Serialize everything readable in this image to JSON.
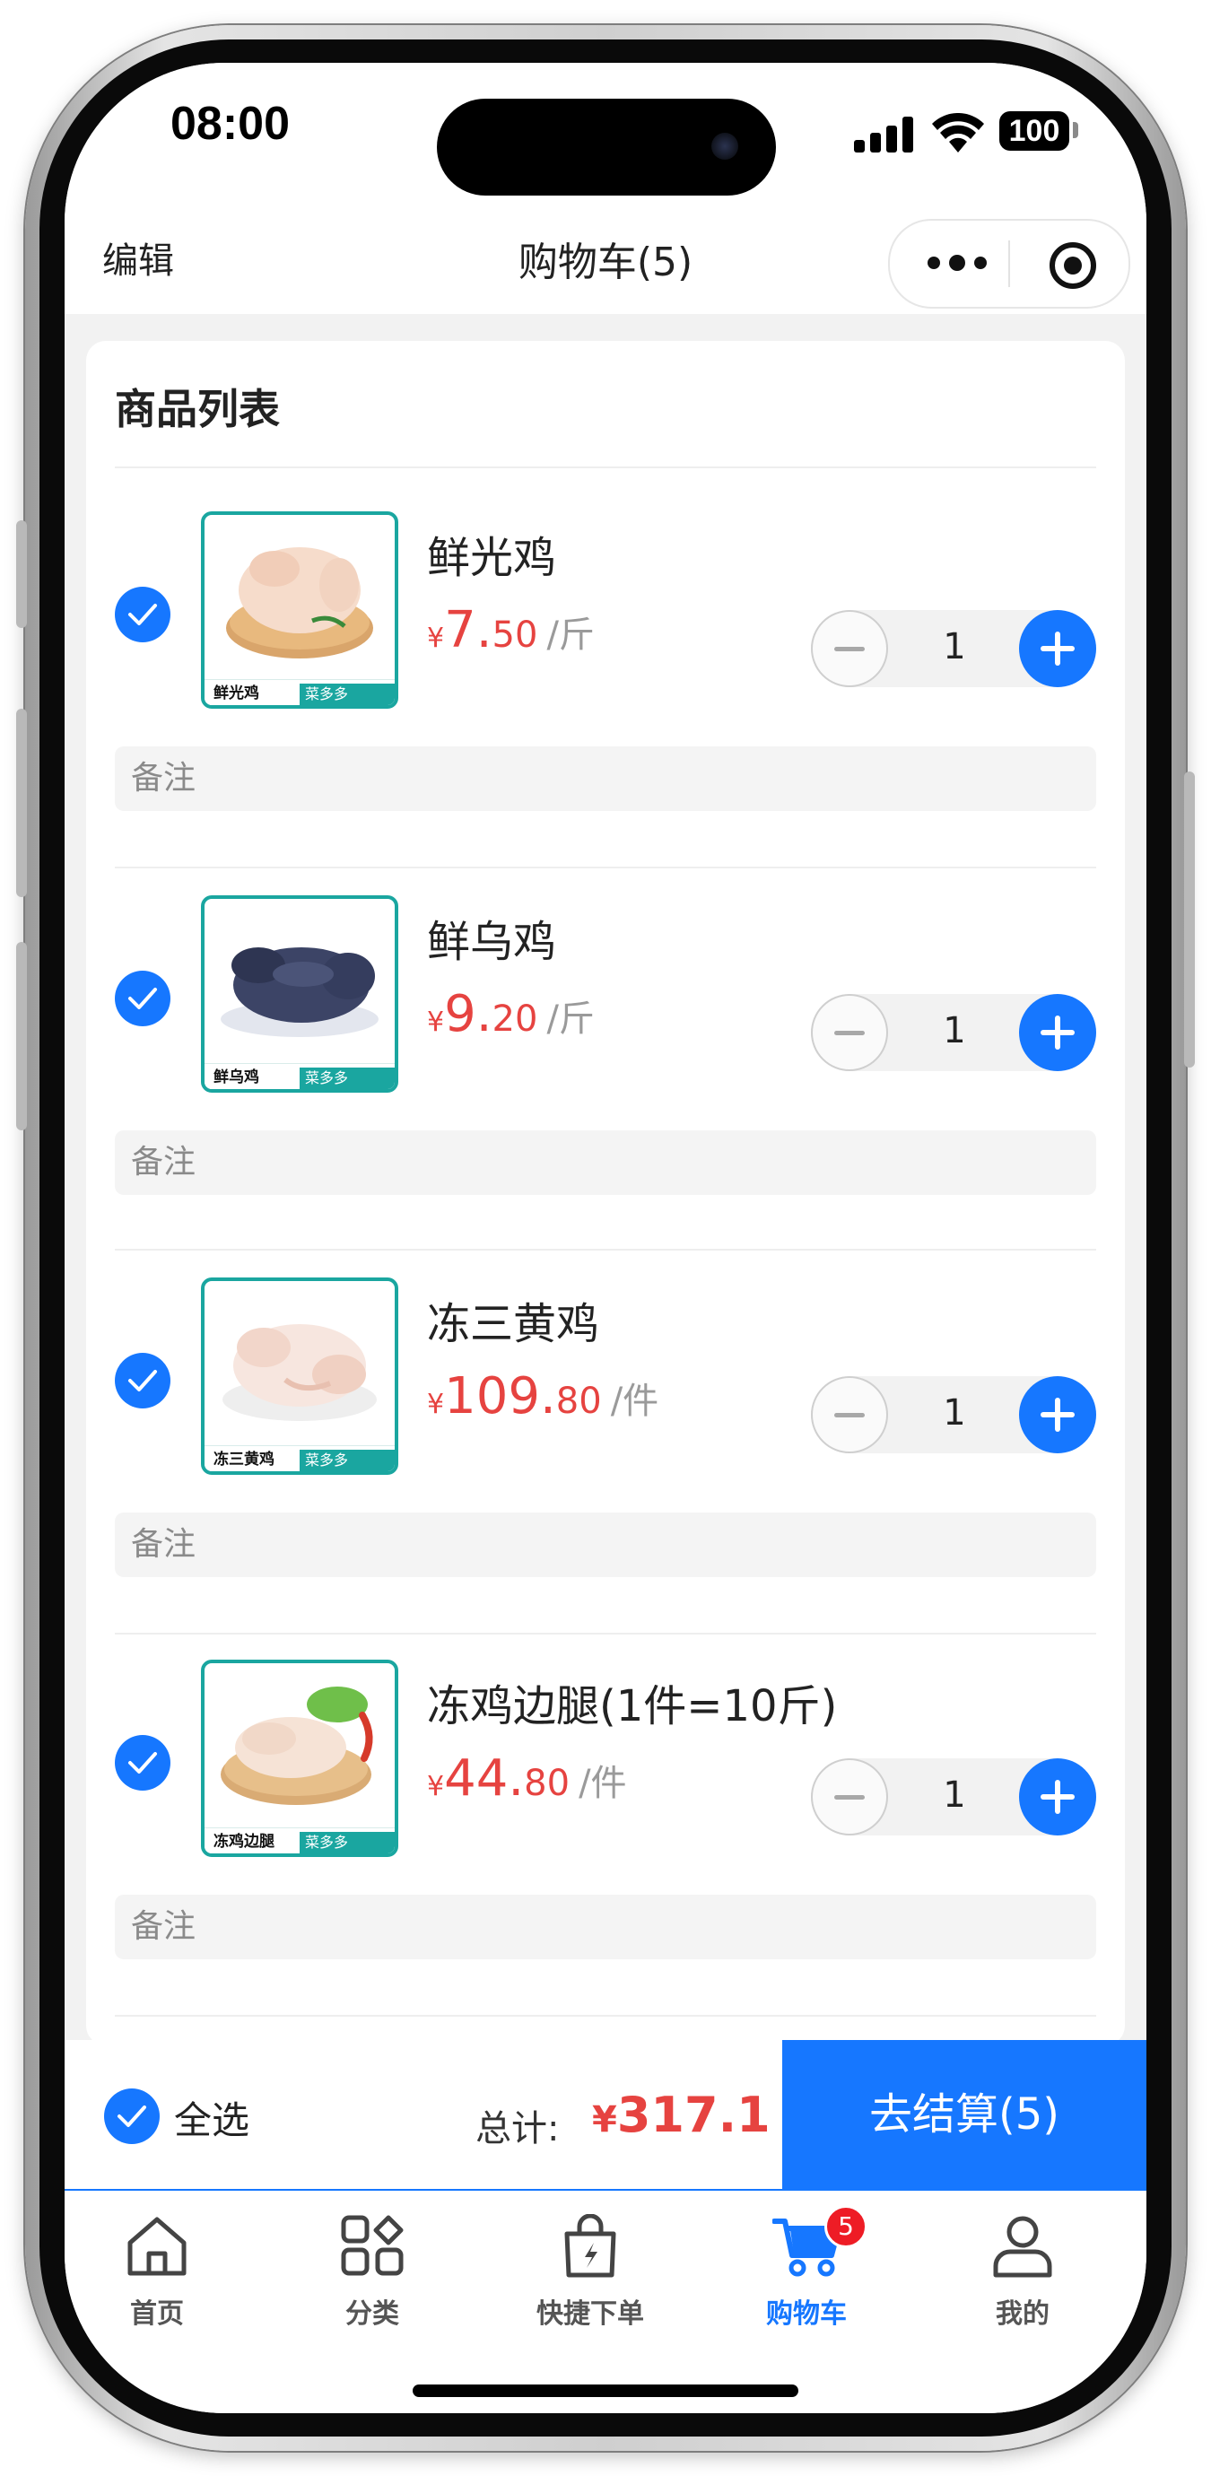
{
  "status_bar": {
    "time": "08:00",
    "battery": "100",
    "icons": [
      "signal-icon",
      "wifi-icon",
      "battery-icon"
    ]
  },
  "nav": {
    "edit_label": "编辑",
    "title": "购物车(5)",
    "menu_icon": "more-dots-icon",
    "close_icon": "target-circle-icon"
  },
  "section": {
    "title": "商品列表"
  },
  "items": [
    {
      "name": "鲜光鸡",
      "price_int": "7.",
      "price_dec": "50",
      "currency": "¥",
      "unit": "/斤",
      "qty": "1",
      "remark_placeholder": "备注",
      "thumb_label": "鲜光鸡",
      "thumb_brand": "菜多多",
      "checked": true
    },
    {
      "name": "鲜乌鸡",
      "price_int": "9.",
      "price_dec": "20",
      "currency": "¥",
      "unit": "/斤",
      "qty": "1",
      "remark_placeholder": "备注",
      "thumb_label": "鲜乌鸡",
      "thumb_brand": "菜多多",
      "checked": true
    },
    {
      "name": "冻三黄鸡",
      "price_int": "109.",
      "price_dec": "80",
      "currency": "¥",
      "unit": "/件",
      "qty": "1",
      "remark_placeholder": "备注",
      "thumb_label": "冻三黄鸡",
      "thumb_brand": "菜多多",
      "checked": true
    },
    {
      "name": "冻鸡边腿(1件=10斤)",
      "price_int": "44.",
      "price_dec": "80",
      "currency": "¥",
      "unit": "/件",
      "qty": "1",
      "remark_placeholder": "备注",
      "thumb_label": "冻鸡边腿",
      "thumb_brand": "菜多多",
      "checked": true
    }
  ],
  "checkout": {
    "select_all_label": "全选",
    "total_label": "总计:",
    "currency": "¥",
    "total_amount": "317.1",
    "button_label": "去结算(5)"
  },
  "tabs": [
    {
      "label": "首页",
      "icon": "home-icon",
      "active": false
    },
    {
      "label": "分类",
      "icon": "category-grid-icon",
      "active": false
    },
    {
      "label": "快捷下单",
      "icon": "quick-order-bag-icon",
      "active": false
    },
    {
      "label": "购物车",
      "icon": "cart-icon",
      "active": true,
      "badge": "5"
    },
    {
      "label": "我的",
      "icon": "user-icon",
      "active": false
    }
  ],
  "colors": {
    "accent": "#1677ff",
    "price": "#e64340",
    "badge": "#ee1c25",
    "thumb_border": "#1aa6a0"
  }
}
